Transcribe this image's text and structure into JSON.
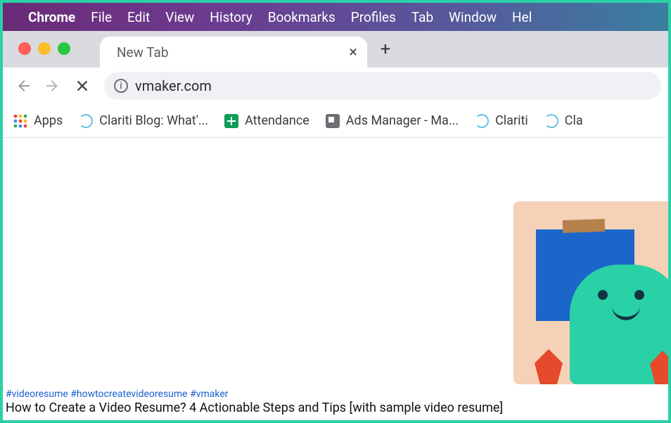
{
  "menubar": {
    "app": "Chrome",
    "items": [
      "File",
      "Edit",
      "View",
      "History",
      "Bookmarks",
      "Profiles",
      "Tab",
      "Window",
      "Hel"
    ]
  },
  "tab": {
    "title": "New Tab"
  },
  "address": {
    "url": "vmaker.com"
  },
  "bookmarks": {
    "apps": "Apps",
    "items": [
      {
        "label": "Clariti Blog: What'...",
        "icon": "clariti"
      },
      {
        "label": "Attendance",
        "icon": "sheets"
      },
      {
        "label": "Ads Manager - Ma...",
        "icon": "ads"
      },
      {
        "label": "Clariti",
        "icon": "clariti"
      },
      {
        "label": "Cla",
        "icon": "clariti"
      }
    ]
  },
  "caption": {
    "tags": "#videoresume #howtocreatevideoresume #vmaker",
    "title": "How to Create a Video Resume? 4 Actionable Steps and Tips [with sample video resume]"
  }
}
